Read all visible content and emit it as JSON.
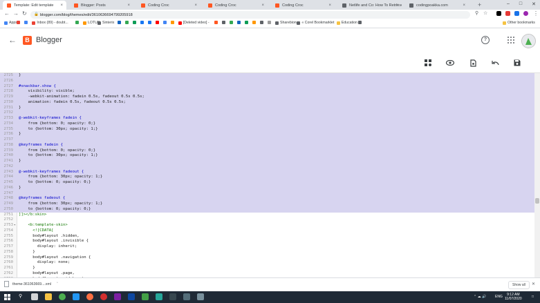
{
  "browser": {
    "tabs": [
      {
        "title": "Template: Edit template",
        "color": "#ff5722",
        "active": true
      },
      {
        "title": "Blogger: Posts",
        "color": "#ff5722"
      },
      {
        "title": "Coding Croc",
        "color": "#ff5722"
      },
      {
        "title": "Coding Croc",
        "color": "#ff5722"
      },
      {
        "title": "Coding Croc",
        "color": "#ff5722"
      },
      {
        "title": "Netlife and Co: How To Retrieve ...",
        "color": "#5f6368"
      },
      {
        "title": "codingpoakka.com",
        "color": "#5f6368"
      }
    ],
    "url": "blogger.com/blog/themes/edit/3610636694799205918",
    "bookmarks": [
      {
        "label": "Apps",
        "color": "#4285f4"
      },
      {
        "label": "",
        "color": "#ea4335"
      },
      {
        "label": "",
        "color": "#4285f4"
      },
      {
        "label": "Inbox (89) - doubt...",
        "color": "#ea4335"
      },
      {
        "label": "",
        "color": "#34a853"
      },
      {
        "label": "LOTUS",
        "color": "#ff9800"
      },
      {
        "label": "Sinterix",
        "color": "#5f6368"
      },
      {
        "label": "",
        "color": "#1565c0"
      },
      {
        "label": "",
        "color": "#34a853"
      },
      {
        "label": "",
        "color": "#0f9d58"
      },
      {
        "label": "",
        "color": "#1877f2"
      },
      {
        "label": "",
        "color": "#1877f2"
      },
      {
        "label": "",
        "color": "#ff0000"
      },
      {
        "label": "",
        "color": "#4285f4"
      },
      {
        "label": "",
        "color": "#ff9800"
      },
      {
        "label": "[Deleted video] -",
        "color": "#ff0000"
      },
      {
        "label": "",
        "color": "#ff5722"
      },
      {
        "label": "",
        "color": "#5f6368"
      },
      {
        "label": "",
        "color": "#34a853"
      },
      {
        "label": "",
        "color": "#1565c0"
      },
      {
        "label": "",
        "color": "#0f9d58"
      },
      {
        "label": "",
        "color": "#ff9800"
      },
      {
        "label": "",
        "color": "#5f6368"
      },
      {
        "label": "",
        "color": "#9e9e9e"
      },
      {
        "label": "Sharebion",
        "color": "#5f6368"
      },
      {
        "label": "« Corel Bookmarklet",
        "color": "#5f6368"
      },
      {
        "label": "Education",
        "color": "#f6c343"
      },
      {
        "label": "",
        "color": "#5f6368"
      },
      {
        "label": "Other bookmarks",
        "color": "#f6c343"
      }
    ]
  },
  "blogger": {
    "title": "Blogger",
    "logo_letter": "B",
    "toolbar_icons": [
      "theme-layout-icon",
      "preview-icon",
      "save-draft-icon",
      "undo-icon",
      "save-icon"
    ]
  },
  "editor": {
    "lines": [
      {
        "n": "2725",
        "code": "}",
        "sel": true
      },
      {
        "n": "2726",
        "code": "",
        "sel": true
      },
      {
        "n": "2727",
        "code": "#snackbar.show {",
        "sel": true
      },
      {
        "n": "2728",
        "code": "    visibility: visible;",
        "sel": true
      },
      {
        "n": "2729",
        "code": "    -webkit-animation: fadein 0.5s, fadeout 0.5s 0.5s;",
        "sel": true
      },
      {
        "n": "2730",
        "code": "    animation: fadein 0.5s, fadeout 0.5s 0.5s;",
        "sel": true
      },
      {
        "n": "2731",
        "code": "}",
        "sel": true
      },
      {
        "n": "2732",
        "code": "",
        "sel": true
      },
      {
        "n": "2733",
        "code": "@-webkit-keyframes fadein {",
        "sel": true
      },
      {
        "n": "2734",
        "code": "    from {bottom: 0; opacity: 0;}",
        "sel": true
      },
      {
        "n": "2735",
        "code": "    to {bottom: 30px; opacity: 1;}",
        "sel": true
      },
      {
        "n": "2736",
        "code": "}",
        "sel": true
      },
      {
        "n": "2737",
        "code": "",
        "sel": true
      },
      {
        "n": "2738",
        "code": "@keyframes fadein {",
        "sel": true
      },
      {
        "n": "2739",
        "code": "    from {bottom: 0; opacity: 0;}",
        "sel": true
      },
      {
        "n": "2740",
        "code": "    to {bottom: 30px; opacity: 1;}",
        "sel": true
      },
      {
        "n": "2741",
        "code": "}",
        "sel": true
      },
      {
        "n": "2742",
        "code": "",
        "sel": true
      },
      {
        "n": "2743",
        "code": "@-webkit-keyframes fadeout {",
        "sel": true
      },
      {
        "n": "2744",
        "code": "    from {bottom: 30px; opacity: 1;}",
        "sel": true
      },
      {
        "n": "2745",
        "code": "    to {bottom: 0; opacity: 0;}",
        "sel": true
      },
      {
        "n": "2746",
        "code": "}",
        "sel": true
      },
      {
        "n": "2747",
        "code": "",
        "sel": true
      },
      {
        "n": "2748",
        "code": "@keyframes fadeout {",
        "sel": true
      },
      {
        "n": "2749",
        "code": "    from {bottom: 30px; opacity: 1;}",
        "sel": true
      },
      {
        "n": "2750",
        "code": "    to {bottom: 0; opacity: 0;}",
        "sel": true
      },
      {
        "n": "2751",
        "code": "]]></b:skin>",
        "sel": false
      },
      {
        "n": "2752",
        "code": "",
        "sel": false
      },
      {
        "n": "2753",
        "code": "    <b:template-skin>",
        "sel": false,
        "fold": true
      },
      {
        "n": "2754",
        "code": "      <![CDATA[",
        "sel": false
      },
      {
        "n": "2755",
        "code": "      body#layout .hidden,",
        "sel": false
      },
      {
        "n": "2756",
        "code": "      body#layout .invisible {",
        "sel": false
      },
      {
        "n": "2757",
        "code": "        display: inherit;",
        "sel": false
      },
      {
        "n": "2758",
        "code": "      }",
        "sel": false
      },
      {
        "n": "2759",
        "code": "      body#layout .navigation {",
        "sel": false
      },
      {
        "n": "2760",
        "code": "        display: none;",
        "sel": false
      },
      {
        "n": "2761",
        "code": "      }",
        "sel": false
      },
      {
        "n": "2762",
        "code": "      body#layout .page,",
        "sel": false
      },
      {
        "n": "2763",
        "code": "      body#layout .sidebar_top,",
        "sel": false
      }
    ]
  },
  "downloads": {
    "file": "theme-361063669....xml",
    "show_all": "Show all"
  },
  "taskbar": {
    "time": "9:12 AM",
    "date": "11/07/2020",
    "lang": "ENG"
  }
}
